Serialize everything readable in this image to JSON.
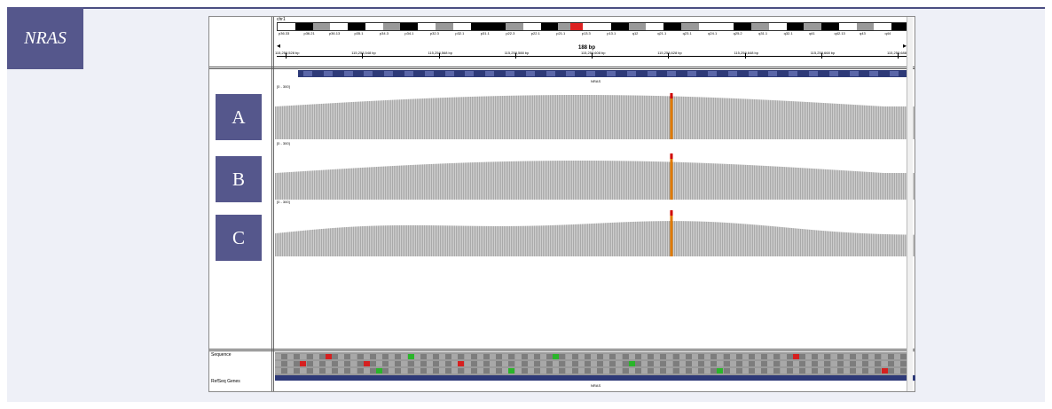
{
  "gene_tag": "NRAS",
  "panels": [
    "A",
    "B",
    "C"
  ],
  "igv": {
    "chromosome": "chr1",
    "band_labels": [
      "p36.33",
      "p36.21",
      "p36.13",
      "p35.1",
      "p34.3",
      "p34.1",
      "p32.3",
      "p32.1",
      "p31.1",
      "p22.3",
      "p22.1",
      "p21.1",
      "p13.3",
      "p13.1",
      "q12",
      "q21.1",
      "q23.1",
      "q24.1",
      "q25.2",
      "q31.1",
      "q32.1",
      "q41",
      "q42.13",
      "q43",
      "q44"
    ],
    "span": "188 bp",
    "ticks": [
      "115,258,528 bp",
      "115,258,548 bp",
      "115,258,568 bp",
      "115,258,588 bp",
      "115,258,608 bp",
      "115,258,628 bp",
      "115,258,648 bp",
      "115,258,668 bp",
      "115,258,688 bp"
    ],
    "gene_name": "NRAS",
    "coverage_ranges": [
      "[0 - 300]",
      "[0 - 300]",
      "[0 - 300]"
    ],
    "sequence_label": "Sequence",
    "refseq_label": "RefSeq Genes",
    "refgene_name": "NRAS"
  },
  "colors": {
    "tag_bg": "#55578c",
    "coverage": "#a9a9a9",
    "variant": "#e07a00",
    "variant_top": "#d00000"
  }
}
